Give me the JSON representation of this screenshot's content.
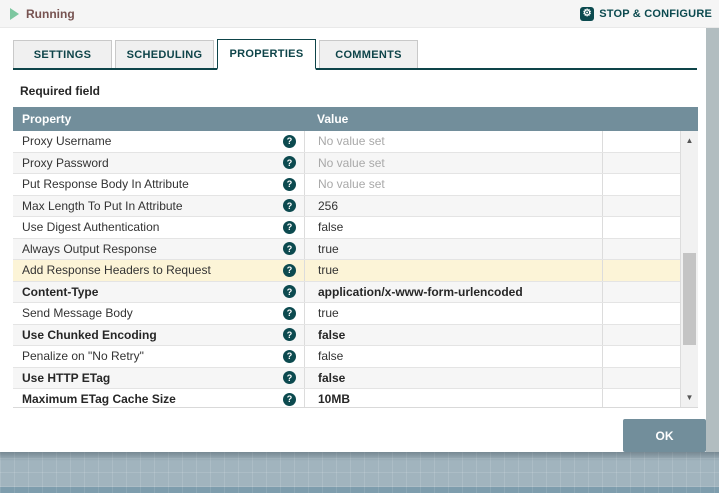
{
  "titlebar": {
    "status_label": "Running",
    "configure_label": "STOP & CONFIGURE"
  },
  "tabs": [
    {
      "label": "SETTINGS",
      "active": false
    },
    {
      "label": "SCHEDULING",
      "active": false
    },
    {
      "label": "PROPERTIES",
      "active": true
    },
    {
      "label": "COMMENTS",
      "active": false
    }
  ],
  "properties_panel": {
    "required_label": "Required field",
    "table": {
      "property_header": "Property",
      "value_header": "Value",
      "help_icon_glyph": "?",
      "rows": [
        {
          "property": "Proxy Username",
          "value": "No value set",
          "unset": true,
          "bold": false,
          "highlight": false
        },
        {
          "property": "Proxy Password",
          "value": "No value set",
          "unset": true,
          "bold": false,
          "highlight": false
        },
        {
          "property": "Put Response Body In Attribute",
          "value": "No value set",
          "unset": true,
          "bold": false,
          "highlight": false
        },
        {
          "property": "Max Length To Put In Attribute",
          "value": "256",
          "unset": false,
          "bold": false,
          "highlight": false
        },
        {
          "property": "Use Digest Authentication",
          "value": "false",
          "unset": false,
          "bold": false,
          "highlight": false
        },
        {
          "property": "Always Output Response",
          "value": "true",
          "unset": false,
          "bold": false,
          "highlight": false
        },
        {
          "property": "Add Response Headers to Request",
          "value": "true",
          "unset": false,
          "bold": false,
          "highlight": true
        },
        {
          "property": "Content-Type",
          "value": "application/x-www-form-urlencoded",
          "unset": false,
          "bold": true,
          "highlight": false
        },
        {
          "property": "Send Message Body",
          "value": "true",
          "unset": false,
          "bold": false,
          "highlight": false
        },
        {
          "property": "Use Chunked Encoding",
          "value": "false",
          "unset": false,
          "bold": true,
          "highlight": false
        },
        {
          "property": "Penalize on \"No Retry\"",
          "value": "false",
          "unset": false,
          "bold": false,
          "highlight": false
        },
        {
          "property": "Use HTTP ETag",
          "value": "false",
          "unset": false,
          "bold": true,
          "highlight": false
        },
        {
          "property": "Maximum ETag Cache Size",
          "value": "10MB",
          "unset": false,
          "bold": true,
          "highlight": false
        }
      ]
    }
  },
  "scrollbar": {
    "up_glyph": "▲",
    "down_glyph": "▼"
  },
  "ok_button_label": "OK",
  "colors": {
    "accent_teal": "#0c4a4f",
    "table_header": "#728E9B",
    "running_green": "#7dc7a0",
    "status_text": "#775351",
    "highlight_row": "#fcf4d7",
    "canvas": "#a1b4be"
  }
}
